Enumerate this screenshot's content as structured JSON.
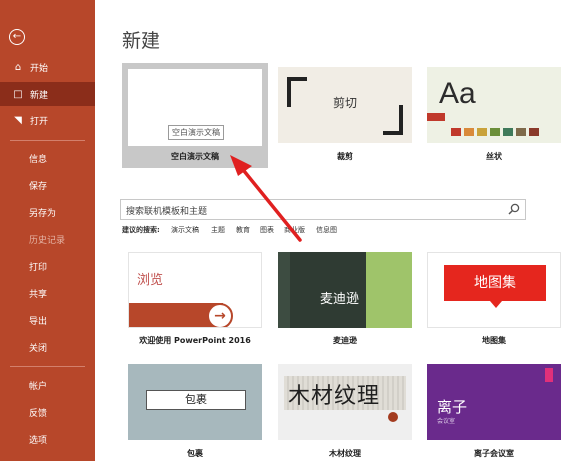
{
  "sidebar": {
    "items": [
      {
        "label": "开始",
        "icon": "home-icon"
      },
      {
        "label": "新建",
        "icon": "new-file-icon"
      },
      {
        "label": "打开",
        "icon": "open-folder-icon"
      },
      {
        "label": "信息"
      },
      {
        "label": "保存"
      },
      {
        "label": "另存为"
      },
      {
        "label": "历史记录"
      },
      {
        "label": "打印"
      },
      {
        "label": "共享"
      },
      {
        "label": "导出"
      },
      {
        "label": "关闭"
      },
      {
        "label": "帐户"
      },
      {
        "label": "反馈"
      },
      {
        "label": "选项"
      }
    ]
  },
  "main": {
    "title": "新建",
    "featured": [
      {
        "caption": "空白演示文稿",
        "thumb_text": "空白演示文稿"
      },
      {
        "caption": "裁剪",
        "thumb_text": "剪切"
      },
      {
        "caption": "丝状",
        "thumb_text": "Aa"
      }
    ],
    "search": {
      "placeholder": "搜索联机模板和主题",
      "suggest_label": "建议的搜索:",
      "suggestions": [
        "演示文稿",
        "主题",
        "教育",
        "图表",
        "商业版",
        "信息图"
      ]
    },
    "templates": [
      {
        "caption": "欢迎使用 PowerPoint 2016",
        "thumb_text": "浏览"
      },
      {
        "caption": "麦迪逊",
        "thumb_text": "麦迪逊"
      },
      {
        "caption": "地图集",
        "thumb_text": "地图集"
      },
      {
        "caption": "包裹",
        "thumb_text": "包裹"
      },
      {
        "caption": "木材纹理",
        "thumb_text": "木材纹理"
      },
      {
        "caption": "离子会议室",
        "thumb_text": "离子",
        "thumb_sub": "会议室"
      }
    ]
  },
  "colors": {
    "sidebar_bg": "#b7472a",
    "sidebar_active": "#8b2d1a",
    "annotation_arrow": "#e02020"
  }
}
